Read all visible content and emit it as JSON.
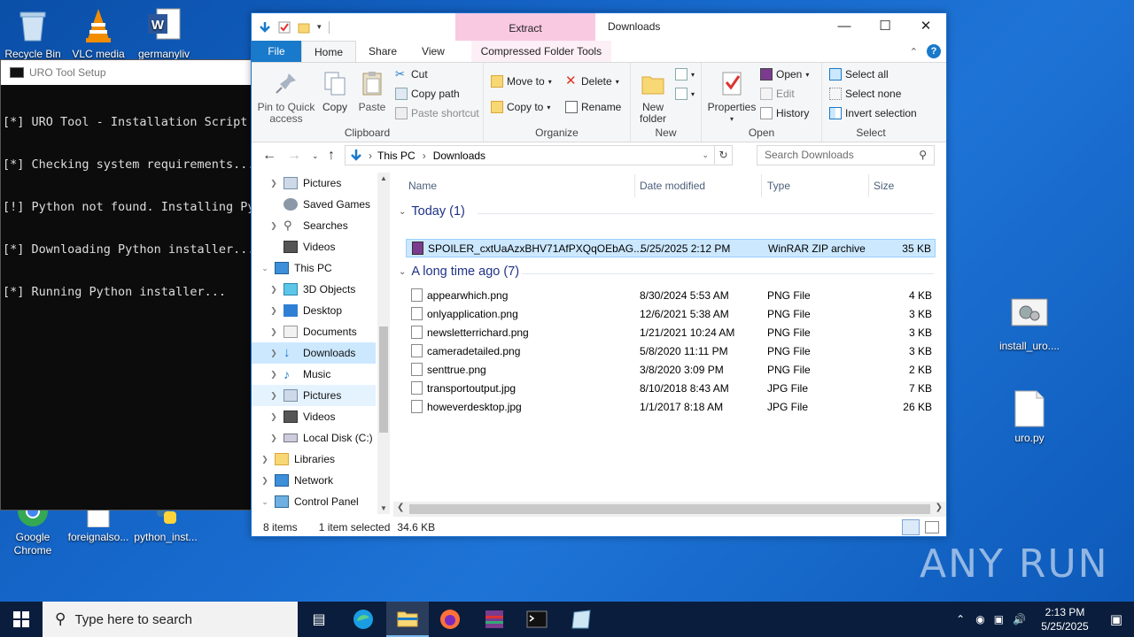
{
  "desktop": {
    "icons": [
      {
        "label": "Recycle Bin"
      },
      {
        "label": "VLC media"
      },
      {
        "label": "germanyliv"
      },
      {
        "label": "Google Chrome"
      },
      {
        "label": "foreignalso..."
      },
      {
        "label": "python_inst..."
      },
      {
        "label": "install_uro...."
      },
      {
        "label": "uro.py"
      }
    ]
  },
  "cmd": {
    "title": "URO Tool Setup",
    "lines": [
      "[*] URO Tool - Installation Script",
      "[*] Checking system requirements...",
      "[!] Python not found. Installing Py",
      "[*] Downloading Python installer...",
      "[*] Running Python installer..."
    ]
  },
  "explorer": {
    "title": "Downloads",
    "extract_tab": "Extract",
    "tabs": {
      "file": "File",
      "home": "Home",
      "share": "Share",
      "view": "View",
      "cft": "Compressed Folder Tools"
    },
    "ribbon": {
      "clipboard": {
        "pin": "Pin to Quick access",
        "copy": "Copy",
        "paste": "Paste",
        "cut": "Cut",
        "copy_path": "Copy path",
        "paste_shortcut": "Paste shortcut",
        "name": "Clipboard"
      },
      "organize": {
        "move_to": "Move to",
        "copy_to": "Copy to",
        "delete": "Delete",
        "rename": "Rename",
        "name": "Organize"
      },
      "new": {
        "new_folder": "New folder",
        "name": "New"
      },
      "open": {
        "properties": "Properties",
        "open": "Open",
        "edit": "Edit",
        "history": "History",
        "name": "Open"
      },
      "select": {
        "select_all": "Select all",
        "select_none": "Select none",
        "invert": "Invert selection",
        "name": "Select"
      }
    },
    "address": {
      "crumb1": "This PC",
      "crumb2": "Downloads"
    },
    "search_placeholder": "Search Downloads",
    "nav": [
      {
        "label": "Pictures"
      },
      {
        "label": "Saved Games"
      },
      {
        "label": "Searches"
      },
      {
        "label": "Videos"
      },
      {
        "label": "This PC"
      },
      {
        "label": "3D Objects"
      },
      {
        "label": "Desktop"
      },
      {
        "label": "Documents"
      },
      {
        "label": "Downloads"
      },
      {
        "label": "Music"
      },
      {
        "label": "Pictures"
      },
      {
        "label": "Videos"
      },
      {
        "label": "Local Disk (C:)"
      },
      {
        "label": "Libraries"
      },
      {
        "label": "Network"
      },
      {
        "label": "Control Panel"
      }
    ],
    "columns": {
      "name": "Name",
      "date": "Date modified",
      "type": "Type",
      "size": "Size"
    },
    "groups": {
      "today": "Today (1)",
      "older": "A long time ago (7)"
    },
    "today_files": [
      {
        "name": "SPOILER_cxtUaAzxBHV71AfPXQqOEbAG...",
        "date": "5/25/2025 2:12 PM",
        "type": "WinRAR ZIP archive",
        "size": "35 KB"
      }
    ],
    "older_files": [
      {
        "name": "appearwhich.png",
        "date": "8/30/2024 5:53 AM",
        "type": "PNG File",
        "size": "4 KB"
      },
      {
        "name": "onlyapplication.png",
        "date": "12/6/2021 5:38 AM",
        "type": "PNG File",
        "size": "3 KB"
      },
      {
        "name": "newsletterrichard.png",
        "date": "1/21/2021 10:24 AM",
        "type": "PNG File",
        "size": "3 KB"
      },
      {
        "name": "cameradetailed.png",
        "date": "5/8/2020 11:11 PM",
        "type": "PNG File",
        "size": "3 KB"
      },
      {
        "name": "senttrue.png",
        "date": "3/8/2020 3:09 PM",
        "type": "PNG File",
        "size": "2 KB"
      },
      {
        "name": "transportoutput.jpg",
        "date": "8/10/2018 8:43 AM",
        "type": "JPG File",
        "size": "7 KB"
      },
      {
        "name": "howeverdesktop.jpg",
        "date": "1/1/2017 8:18 AM",
        "type": "JPG File",
        "size": "26 KB"
      }
    ],
    "status": {
      "items": "8 items",
      "selected": "1 item selected",
      "size": "34.6 KB"
    }
  },
  "taskbar": {
    "search_placeholder": "Type here to search",
    "time": "2:13 PM",
    "date": "5/25/2025"
  },
  "watermark": "ANY RUN"
}
